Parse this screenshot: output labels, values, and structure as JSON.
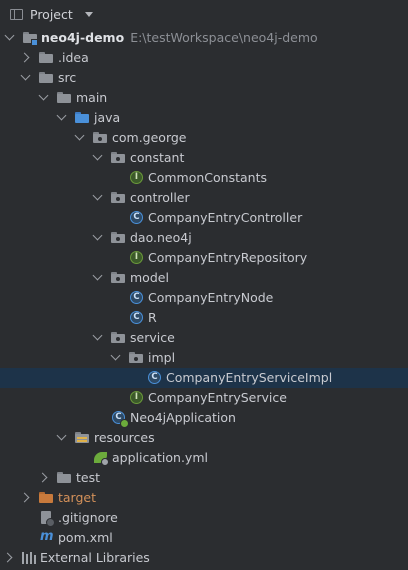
{
  "header": {
    "title": "Project"
  },
  "tree": [
    {
      "label": "neo4j-demo",
      "path": "E:\\testWorkspace\\neo4j-demo",
      "kind": "module"
    },
    {
      "label": ".idea",
      "kind": "folder-gray"
    },
    {
      "label": "src",
      "kind": "folder-gray"
    },
    {
      "label": "main",
      "kind": "folder-gray"
    },
    {
      "label": "java",
      "kind": "folder-blue"
    },
    {
      "label": "com.george",
      "kind": "package"
    },
    {
      "label": "constant",
      "kind": "package"
    },
    {
      "label": "CommonConstants",
      "kind": "interface"
    },
    {
      "label": "controller",
      "kind": "package"
    },
    {
      "label": "CompanyEntryController",
      "kind": "class"
    },
    {
      "label": "dao.neo4j",
      "kind": "package"
    },
    {
      "label": "CompanyEntryRepository",
      "kind": "interface"
    },
    {
      "label": "model",
      "kind": "package"
    },
    {
      "label": "CompanyEntryNode",
      "kind": "class"
    },
    {
      "label": "R",
      "kind": "class"
    },
    {
      "label": "service",
      "kind": "package"
    },
    {
      "label": "impl",
      "kind": "package"
    },
    {
      "label": "CompanyEntryServiceImpl",
      "kind": "class"
    },
    {
      "label": "CompanyEntryService",
      "kind": "interface"
    },
    {
      "label": "Neo4jApplication",
      "kind": "spring-class"
    },
    {
      "label": "resources",
      "kind": "folder-resources"
    },
    {
      "label": "application.yml",
      "kind": "yml"
    },
    {
      "label": "test",
      "kind": "folder-gray"
    },
    {
      "label": "target",
      "kind": "folder-orange"
    },
    {
      "label": ".gitignore",
      "kind": "gitignore"
    },
    {
      "label": "pom.xml",
      "kind": "maven"
    },
    {
      "label": "External Libraries",
      "kind": "libraries"
    }
  ],
  "colors": {
    "background": "#2b2d30",
    "selection": "#1d3349",
    "accent_blue": "#4a90d9",
    "interface_green": "#6a9a3a",
    "excluded_orange": "#c87a3c"
  }
}
